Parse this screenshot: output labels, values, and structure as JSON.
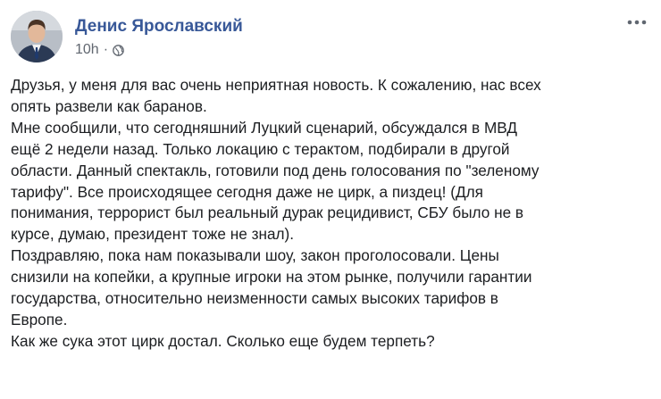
{
  "post": {
    "author": {
      "name": "Денис Ярославский"
    },
    "meta": {
      "time": "10h",
      "separator": "·",
      "audience_icon": "globe-icon"
    },
    "more_icon": "more-dots-icon",
    "lines": [
      "Друзья, у меня для вас очень неприятная новость. К сожалению, нас всех",
      "опять развели как баранов.",
      "Мне сообщили, что сегодняшний Луцкий сценарий, обсуждался в МВД",
      "ещё 2 недели назад. Только локацию с терактом, подбирали в другой",
      "области. Данный спектакль, готовили под день голосования по \"зеленому",
      "тарифу\". Все происходящее сегодня даже не цирк, а пиздец! (Для",
      "понимания, террорист был реальный дурак рецидивист, СБУ было не в",
      "курсе, думаю, президент тоже не знал).",
      "Поздравляю, пока нам показывали шоу, закон проголосовали. Цены",
      "снизили на копейки, а крупные игроки на этом рынке, получили гарантии",
      "государства, относительно неизменности самых высоких тарифов в",
      "Европе.",
      "Как же сука этот цирк достал. Сколько еще будем терпеть?"
    ]
  },
  "colors": {
    "author_link": "#385898",
    "meta_text": "#616770",
    "body_text": "#1c1e21"
  }
}
